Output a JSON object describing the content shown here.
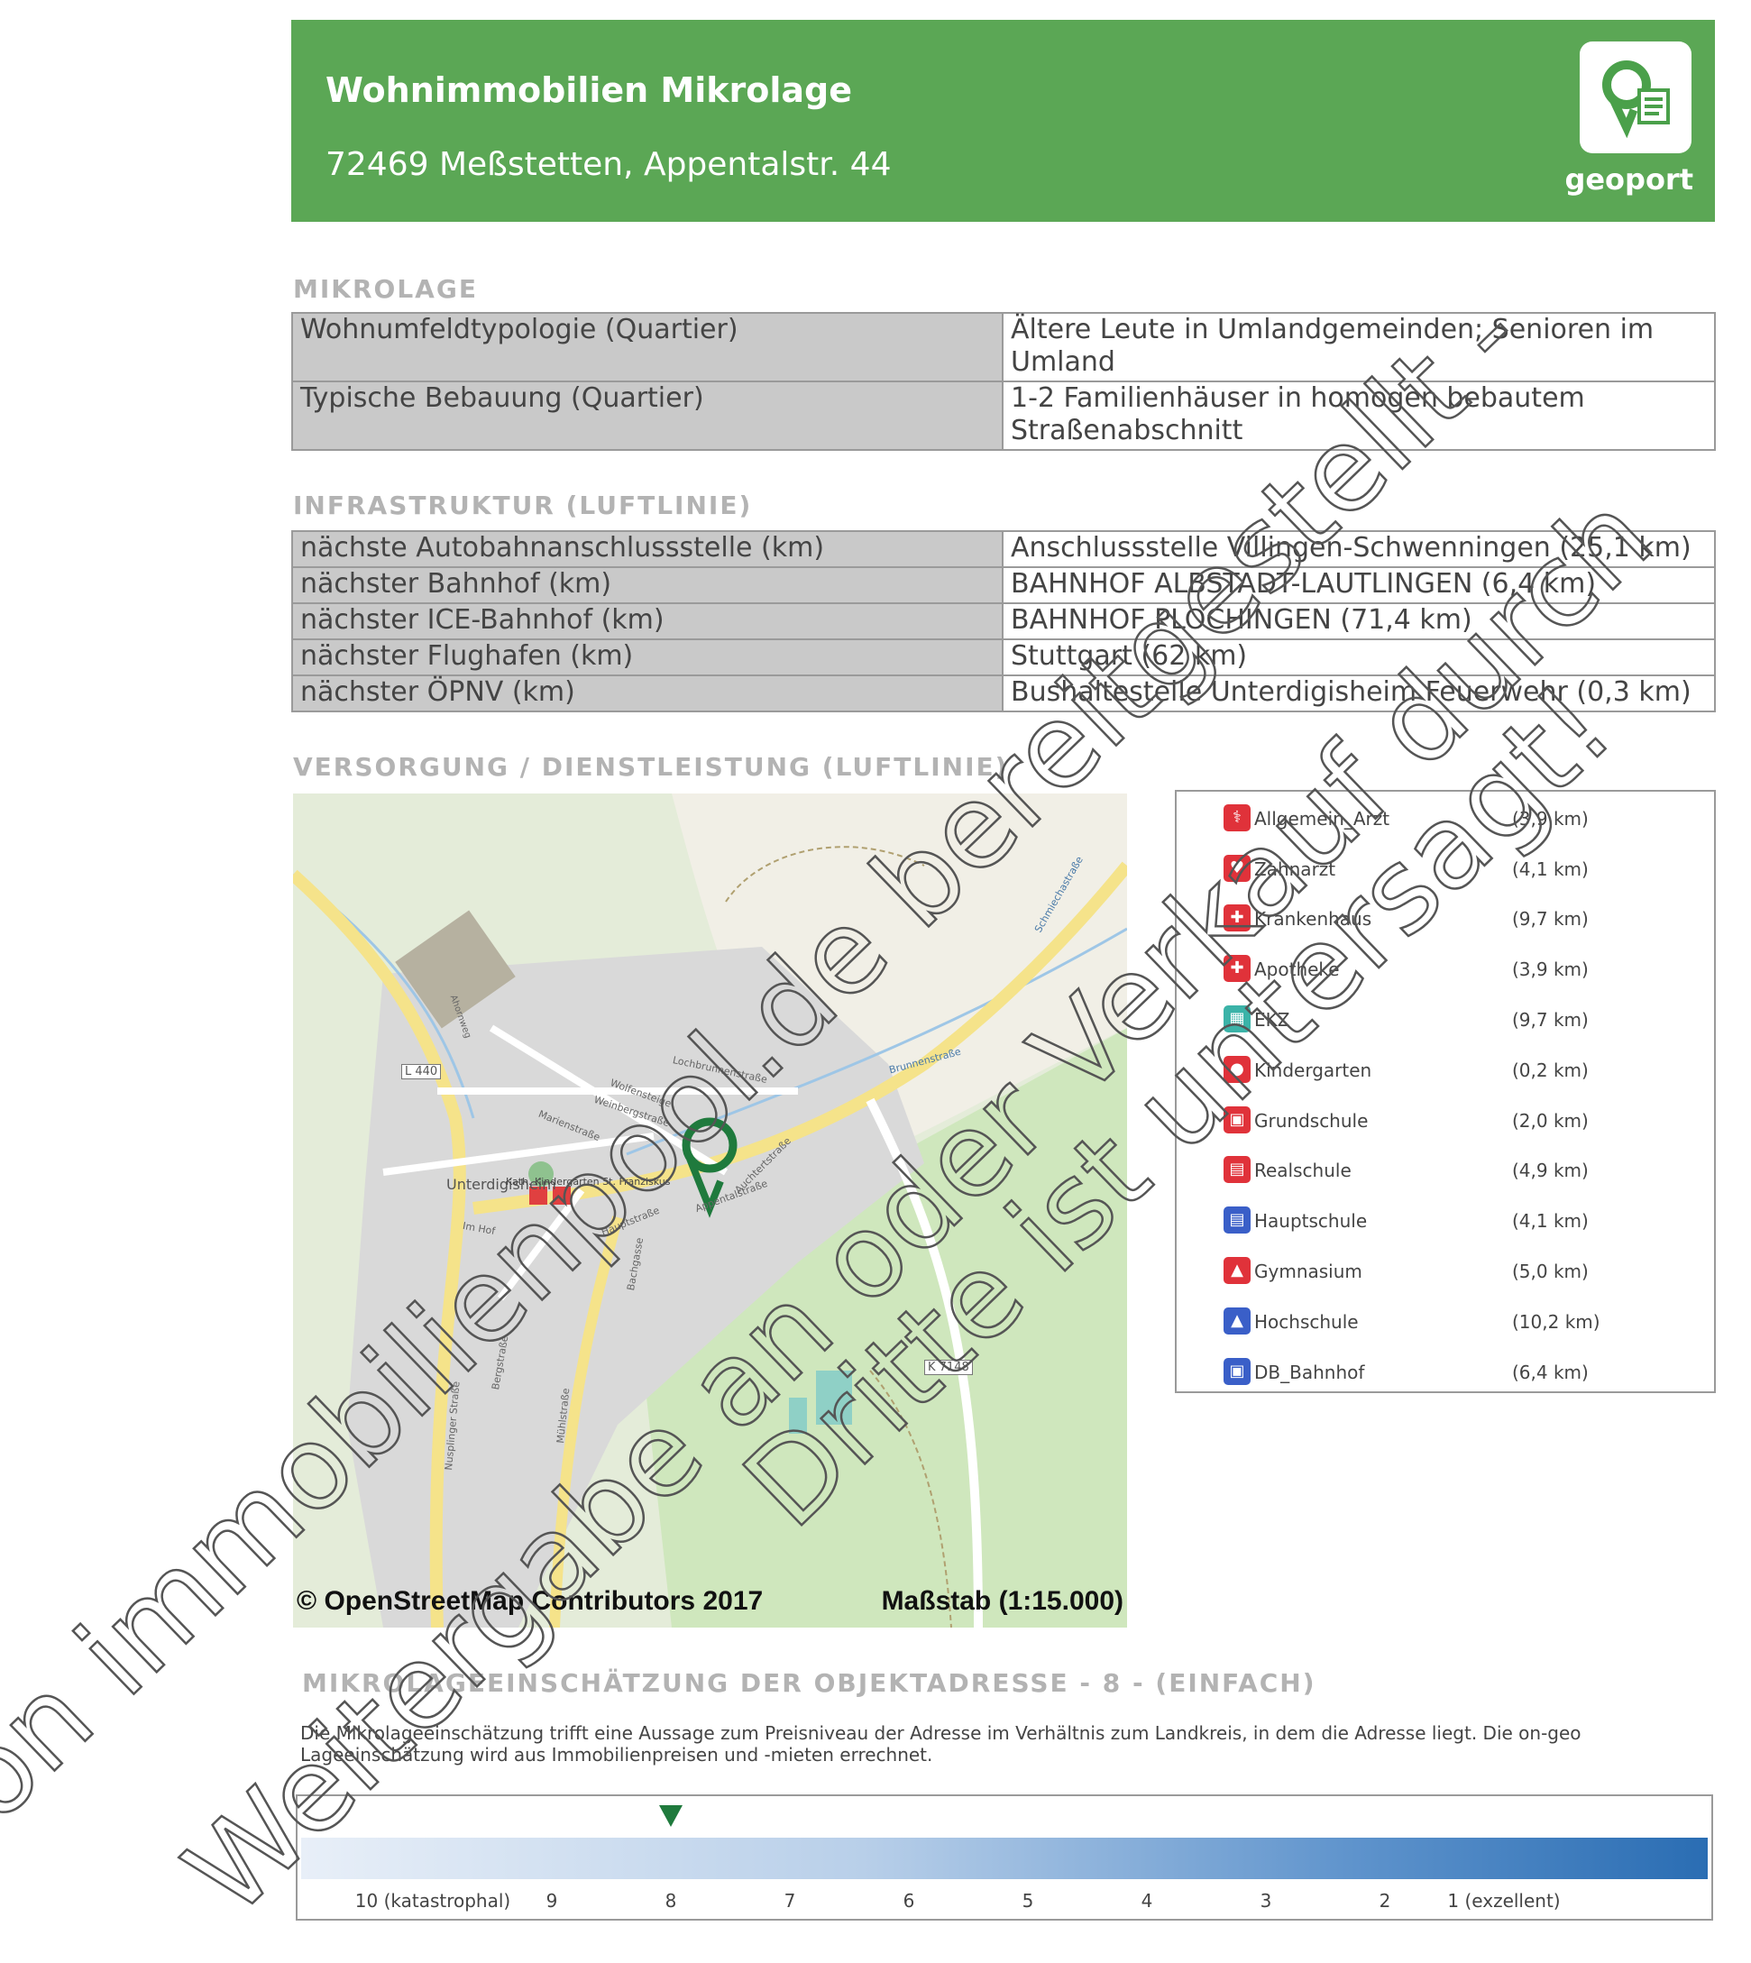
{
  "header": {
    "title": "Wohnimmobilien Mikrolage",
    "address": "72469 Meßstetten, Appentalstr. 44",
    "logo_text": "geoport"
  },
  "mikrolage": {
    "heading": "MIKROLAGE",
    "rows": [
      {
        "label": "Wohnumfeldtypologie (Quartier)",
        "value": "Ältere Leute in Umlandgemeinden; Senioren im Umland"
      },
      {
        "label": "Typische Bebauung (Quartier)",
        "value": "1-2 Familienhäuser in homogen bebautem Straßenabschnitt"
      }
    ]
  },
  "infrastruktur": {
    "heading": "INFRASTRUKTUR (LUFTLINIE)",
    "rows": [
      {
        "label": "nächste Autobahnanschlussstelle (km)",
        "value": "Anschlussstelle Villingen-Schwenningen (25,1 km)"
      },
      {
        "label": "nächster Bahnhof (km)",
        "value": "BAHNHOF ALBSTADT-LAUTLINGEN (6,4 km)"
      },
      {
        "label": "nächster ICE-Bahnhof (km)",
        "value": "BAHNHOF PLOCHINGEN (71,4 km)"
      },
      {
        "label": "nächster Flughafen (km)",
        "value": "Stuttgart (62 km)"
      },
      {
        "label": "nächster ÖPNV (km)",
        "value": "Bushaltestelle Unterdigisheim Feuerwehr (0,3 km)"
      }
    ]
  },
  "versorgung": {
    "heading": "VERSORGUNG / DIENSTLEISTUNG (LUFTLINIE)",
    "map_credit": "© OpenStreetMap Contributors 2017",
    "map_scale": "Maßstab (1:15.000)",
    "map_labels": {
      "l440": "L 440",
      "k7148": "K 7148",
      "place": "Unterdigisheim",
      "kita": "Kath. Kindergarten St. Franziskus",
      "s1": "Ahornweg",
      "s2": "Lochbrunnenstraße",
      "s3": "Wolfensteige",
      "s4": "Weinbergstraße",
      "s5": "Marienstraße",
      "s6": "Hauptstraße",
      "s7": "Appentalstraße",
      "s8": "Im Hof",
      "s9": "Bachgasse",
      "s10": "Mühlstraße",
      "s11": "Auchtertstraße",
      "s12": "Bergstraße",
      "s13": "Schmiechastraße",
      "s14": "Nusplinger Straße",
      "s15": "Brunnenstraße"
    },
    "legend": [
      {
        "icon": "doctor-icon",
        "label": "Allgemein_Arzt",
        "distance": "(3,9 km)",
        "color": "#e0323a"
      },
      {
        "icon": "tooth-icon",
        "label": "Zahnarzt",
        "distance": "(4,1 km)",
        "color": "#e0323a"
      },
      {
        "icon": "hospital-icon",
        "label": "Krankenhaus",
        "distance": "(9,7 km)",
        "color": "#e0323a"
      },
      {
        "icon": "pharmacy-icon",
        "label": "Apotheke",
        "distance": "(3,9 km)",
        "color": "#e0323a"
      },
      {
        "icon": "shopping-cart-icon",
        "label": "EKZ",
        "distance": "(9,7 km)",
        "color": "#3bb3a8"
      },
      {
        "icon": "kindergarten-icon",
        "label": "Kindergarten",
        "distance": "(0,2 km)",
        "color": "#e0323a"
      },
      {
        "icon": "primary-school-icon",
        "label": "Grundschule",
        "distance": "(2,0 km)",
        "color": "#e0323a"
      },
      {
        "icon": "secondary-school-icon",
        "label": "Realschule",
        "distance": "(4,9 km)",
        "color": "#e0323a"
      },
      {
        "icon": "main-school-icon",
        "label": "Hauptschule",
        "distance": "(4,1 km)",
        "color": "#3a5fc8"
      },
      {
        "icon": "gymnasium-icon",
        "label": "Gymnasium",
        "distance": "(5,0 km)",
        "color": "#e0323a"
      },
      {
        "icon": "university-icon",
        "label": "Hochschule",
        "distance": "(10,2 km)",
        "color": "#3a5fc8"
      },
      {
        "icon": "train-icon",
        "label": "DB_Bahnhof",
        "distance": "(6,4 km)",
        "color": "#3a5fc8"
      }
    ]
  },
  "einschaetzung": {
    "heading": "MIKROLAGEEINSCHÄTZUNG DER OBJEKTADRESSE - 8 - (EINFACH)",
    "description": "Die Mikrolageeinschätzung trifft eine Aussage zum Preisniveau der Adresse im Verhältnis zum Landkreis, in dem die Adresse liegt. Die on-geo Lageeinschätzung wird aus Immobilienpreisen und -mieten errechnet.",
    "rating": 8,
    "ticks": [
      "10 (katastrophal)",
      "9",
      "8",
      "7",
      "6",
      "5",
      "4",
      "3",
      "2",
      "1 (exzellent)"
    ]
  },
  "watermark": {
    "line1": "Von immobilienpool.de bereitgestellt -",
    "line2": "Weitergabe an oder Verkauf durch",
    "line3": "Dritte ist untersagt!"
  },
  "colors": {
    "header_green": "#5ba755",
    "section_gray": "#b3b3b3",
    "marker_green": "#1f7a3d",
    "scale_blue": "#2a6db3"
  }
}
